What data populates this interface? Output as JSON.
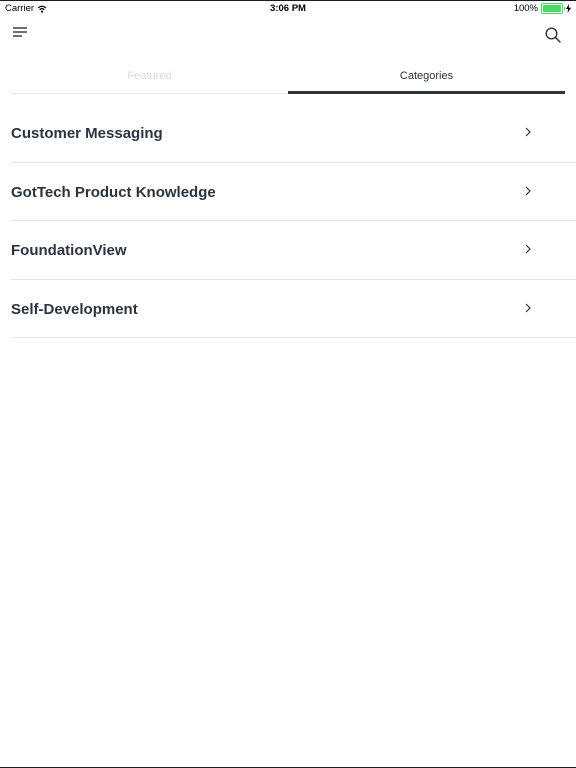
{
  "status_bar": {
    "carrier": "Carrier",
    "time": "3:06 PM",
    "battery_percent": "100%",
    "battery_level": 1.0,
    "wifi_icon": "wifi-icon",
    "charging_icon": "bolt-icon"
  },
  "nav": {
    "menu_icon": "menu-icon",
    "search_icon": "search-icon"
  },
  "tabs": [
    {
      "label": "Featured",
      "active": false
    },
    {
      "label": "Categories",
      "active": true
    }
  ],
  "categories": [
    {
      "label": "Customer Messaging"
    },
    {
      "label": "GotTech Product Knowledge"
    },
    {
      "label": "FoundationView"
    },
    {
      "label": "Self-Development"
    }
  ],
  "colors": {
    "text_primary": "#2b3440",
    "tab_inactive": "#d8dadd",
    "divider": "#e1e3e6",
    "battery": "#4cd964"
  }
}
